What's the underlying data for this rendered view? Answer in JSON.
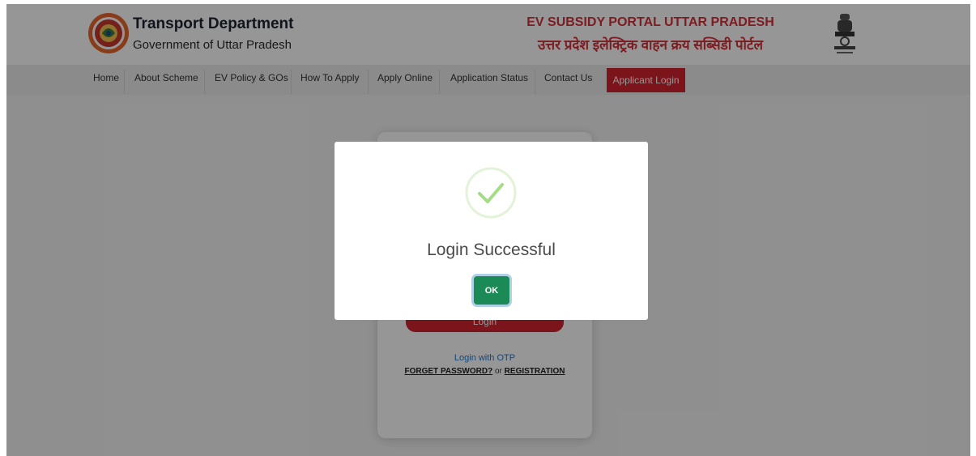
{
  "header": {
    "dept_title": "Transport Department",
    "dept_subtitle": "Government of Uttar Pradesh",
    "portal_title_en": "EV SUBSIDY PORTAL UTTAR PRADESH",
    "portal_title_hi": "उत्तर प्रदेश इलेक्ट्रिक वाहन क्रय सब्सिडी पोर्टल",
    "logo_icon": "up-government-seal-icon",
    "emblem_icon": "national-emblem-icon"
  },
  "nav": {
    "items": [
      {
        "label": "Home"
      },
      {
        "label": "About Scheme"
      },
      {
        "label": "EV Policy & GOs"
      },
      {
        "label": "How To Apply"
      },
      {
        "label": "Apply Online"
      },
      {
        "label": "Application Status"
      },
      {
        "label": "Contact Us"
      }
    ],
    "active": {
      "label": "Applicant Login"
    }
  },
  "login_card": {
    "login_button": "Login",
    "otp_link": "Login with OTP",
    "forget_password": "FORGET PASSWORD?",
    "or_text": "or",
    "registration": "REGISTRATION"
  },
  "modal": {
    "icon": "success-check-icon",
    "title": "Login Successful",
    "ok_label": "OK"
  },
  "colors": {
    "accent_red": "#d1232f",
    "ok_green": "#1c8a57",
    "check_green": "#a5dc86"
  }
}
